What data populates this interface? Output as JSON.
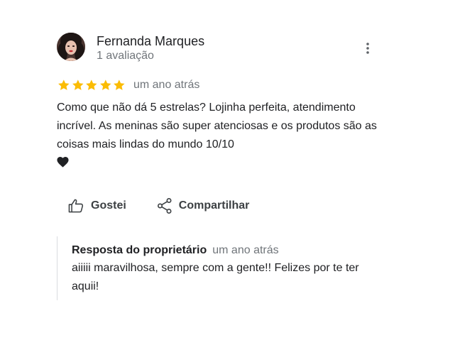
{
  "review": {
    "author_name": "Fernanda Marques",
    "author_meta": "1 avaliação",
    "rating": 5,
    "rating_max": 5,
    "date": "um ano atrás",
    "text": "Como que não dá 5 estrelas? Lojinha perfeita, atendimento incrível. As meninas são super atenciosas e os produtos são as coisas mais lindas do mundo 10/10",
    "heart_icon": "black-heart-icon",
    "star_color": "#fbbc04"
  },
  "actions": {
    "like_label": "Gostei",
    "share_label": "Compartilhar"
  },
  "reply": {
    "owner_label": "Resposta do proprietário",
    "date": "um ano atrás",
    "text": "aiiiii maravilhosa, sempre com a gente!! Felizes por te ter aquii!"
  }
}
